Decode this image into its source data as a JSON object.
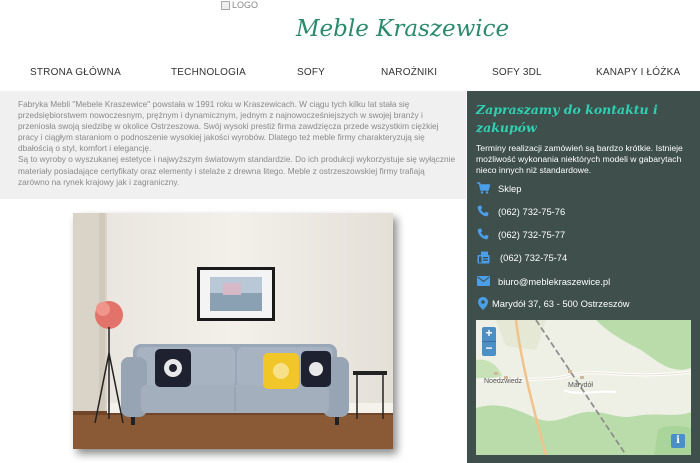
{
  "header": {
    "logo_alt": "LOGO",
    "site_title": "Meble Kraszewice"
  },
  "nav": {
    "items": [
      {
        "label": "STRONA GŁÓWNA"
      },
      {
        "label": "TECHNOLOGIA"
      },
      {
        "label": "SOFY"
      },
      {
        "label": "NAROŻNIKI"
      },
      {
        "label": "SOFY 3DL"
      },
      {
        "label": "KANAPY I ŁÓŻKA"
      }
    ]
  },
  "intro": {
    "paragraph_1": "Fabryka Mebli \"Mebele Kraszewice\" powstała w 1991 roku w Kraszewicach. W ciągu tych kilku lat stała się przedsiębiorstwem nowoczesnym, prężnym i dynamicznym, jednym z najnowocześniejszych w swojej branży i przeniosła swoją siedzibę w okolice Ostrzeszowa. Swój wysoki prestiż firma zawdzięcza przede wszystkim ciężkiej pracy i ciągłym staraniom o podnoszenie wysokiej jakości wyrobów. Dlatego też meble firmy charakteryzują się dbałością o styl, komfort i elegancję.",
    "paragraph_2": "Są to wyroby o wyszukanej estetyce i najwyższym światowym standardzie. Do ich produkcji wykorzystuje się wyłącznie materiały posiadające certyfikaty oraz elementy i stelaże z drewna litego. Meble z ostrzeszowskiej firmy trafiają zarówno na rynek krajowy jak i zagraniczny."
  },
  "contact": {
    "title": "Zapraszamy do kontaktu i zakupów",
    "description": "Terminy realizacji zamówień są bardzo krótkie. Istnieje możliwość wykonania niektórych modeli w gabarytach nieco innych niż standardowe.",
    "shop_label": "Sklep",
    "phone_1": "(062) 732-75-76",
    "phone_2": "(062) 732-75-77",
    "fax": "(062) 732-75-74",
    "email": "biuro@meblekraszewice.pl",
    "address": "Marydół 37, 63 - 500 Ostrzeszów"
  },
  "map": {
    "zoom_in": "+",
    "zoom_out": "−",
    "info": "i",
    "label_1": "Noedzwiedz",
    "label_2": "Marydół"
  },
  "colors": {
    "accent_green": "#2b8a6e",
    "contact_bg": "#3e4f4c",
    "contact_title": "#2fd1b2",
    "icon_blue": "#4b9ee8"
  }
}
